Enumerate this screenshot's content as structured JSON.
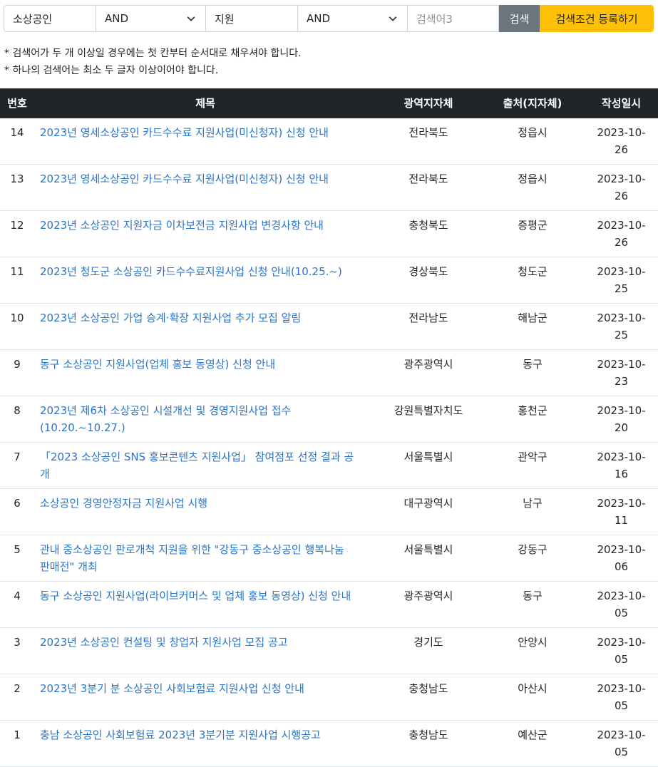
{
  "search": {
    "term1": "소상공인",
    "op1": "AND",
    "term2": "지원",
    "op2": "AND",
    "term3_placeholder": "검색어3",
    "search_label": "검색",
    "register_label": "검색조건 등록하기"
  },
  "notes": [
    "* 검색어가 두 개 이상일 경우에는 첫 칸부터 순서대로 채우셔야 합니다.",
    "* 하나의 검색어는 최소 두 글자 이상이어야 합니다."
  ],
  "table": {
    "headers": [
      "번호",
      "제목",
      "광역지자체",
      "출처(지자체)",
      "작성일시"
    ],
    "rows": [
      {
        "no": "14",
        "title": "2023년 영세소상공인 카드수수료 지원사업(미신청자) 신청 안내",
        "region": "전라북도",
        "source": "정읍시",
        "date": "2023-10-26"
      },
      {
        "no": "13",
        "title": "2023년 영세소상공인 카드수수료 지원사업(미신청자) 신청 안내",
        "region": "전라북도",
        "source": "정읍시",
        "date": "2023-10-26"
      },
      {
        "no": "12",
        "title": "2023년 소상공인 지원자금 이차보전금 지원사업 변경사항 안내",
        "region": "충청북도",
        "source": "증평군",
        "date": "2023-10-26"
      },
      {
        "no": "11",
        "title": "2023년 청도군 소상공인 카드수수료지원사업 신청 안내(10.25.~)",
        "region": "경상북도",
        "source": "청도군",
        "date": "2023-10-25"
      },
      {
        "no": "10",
        "title": "2023년 소상공인 가업 승계·확장 지원사업 추가 모집 알림",
        "region": "전라남도",
        "source": "해남군",
        "date": "2023-10-25"
      },
      {
        "no": "9",
        "title": "동구 소상공인 지원사업(업체 홍보 동영상) 신청 안내",
        "region": "광주광역시",
        "source": "동구",
        "date": "2023-10-23"
      },
      {
        "no": "8",
        "title": "2023년 제6차 소상공인 시설개선 및 경영지원사업 접수(10.20.~10.27.)",
        "region": "강원특별자치도",
        "source": "홍천군",
        "date": "2023-10-20"
      },
      {
        "no": "7",
        "title": "「2023 소상공인 SNS 홍보콘텐츠 지원사업」 참여점포 선정 결과 공개",
        "region": "서울특별시",
        "source": "관악구",
        "date": "2023-10-16"
      },
      {
        "no": "6",
        "title": "소상공인 경영안정자금 지원사업 시행",
        "region": "대구광역시",
        "source": "남구",
        "date": "2023-10-11"
      },
      {
        "no": "5",
        "title": "관내 중소상공인 판로개척 지원을 위한 \"강동구 중소상공인 행복나눔 판매전\" 개최",
        "region": "서울특별시",
        "source": "강동구",
        "date": "2023-10-06"
      },
      {
        "no": "4",
        "title": "동구 소상공인 지원사업(라이브커머스 및 업체 홍보 동영상) 신청 안내",
        "region": "광주광역시",
        "source": "동구",
        "date": "2023-10-05"
      },
      {
        "no": "3",
        "title": "2023년 소상공인 컨설팅 및 창업자 지원사업 모집 공고",
        "region": "경기도",
        "source": "안양시",
        "date": "2023-10-05"
      },
      {
        "no": "2",
        "title": "2023년 3분기 분 소상공인 사회보험료 지원사업 신청 안내",
        "region": "충청남도",
        "source": "아산시",
        "date": "2023-10-05"
      },
      {
        "no": "1",
        "title": "충남 소상공인 사회보험료 2023년 3분기분 지원사업 시행공고",
        "region": "충청남도",
        "source": "예산군",
        "date": "2023-10-05"
      }
    ]
  },
  "colors": {
    "header_bg": "#212529",
    "link": "#2a74c9",
    "search_button": "#6c757d",
    "register_button": "#ffc107"
  }
}
